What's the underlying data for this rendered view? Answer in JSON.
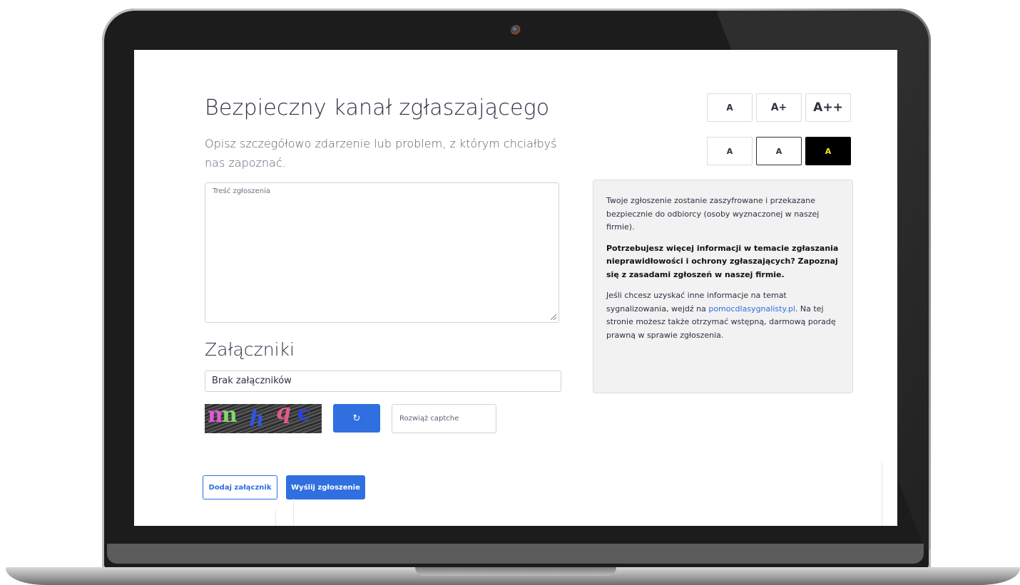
{
  "page": {
    "title": "Bezpieczny kanał zgłaszającego",
    "subtitle": "Opisz szczegółowo zdarzenie lub problem, z którym chciałbyś nas zapoznać."
  },
  "report": {
    "placeholder": "Treść zgłoszenia"
  },
  "attachments": {
    "heading": "Załączniki",
    "empty_text": "Brak załączników"
  },
  "captcha": {
    "image_text": "mn h q c",
    "refresh_icon": "↻",
    "input_placeholder": "Rozwiąż captche"
  },
  "actions": {
    "add_attachment_label": "Dodaj załącznik",
    "submit_label": "Wyślij zgłoszenie"
  },
  "accessibility": {
    "font_size_buttons": [
      "A",
      "A+",
      "A++"
    ],
    "contrast_buttons": [
      "A",
      "A",
      "A"
    ]
  },
  "info_panel": {
    "paragraph1": "Twoje zgłoszenie zostanie zaszyfrowane i przekazane bezpiecznie do odbiorcy (osoby wyznaczonej w naszej firmie).",
    "paragraph2": "Potrzebujesz więcej informacji w temacie zgłaszania nieprawidłowości i ochrony zgłaszających? Zapoznaj się z zasadami zgłoszeń w naszej firmie.",
    "paragraph3_before": "Jeśli chcesz uzyskać inne informacje na temat sygnalizowania, wejdź na ",
    "paragraph3_link": "pomocdlasygnalisty.pl",
    "paragraph3_after": ". Na tej stronie możesz także otrzymać wstępną, darmową poradę prawną w sprawie zgłoszenia."
  },
  "colors": {
    "primary": "#2f6fe0",
    "contrast_active_bg": "#000000",
    "contrast_active_fg": "#f6e31a",
    "info_bg": "#f2f2f2"
  }
}
